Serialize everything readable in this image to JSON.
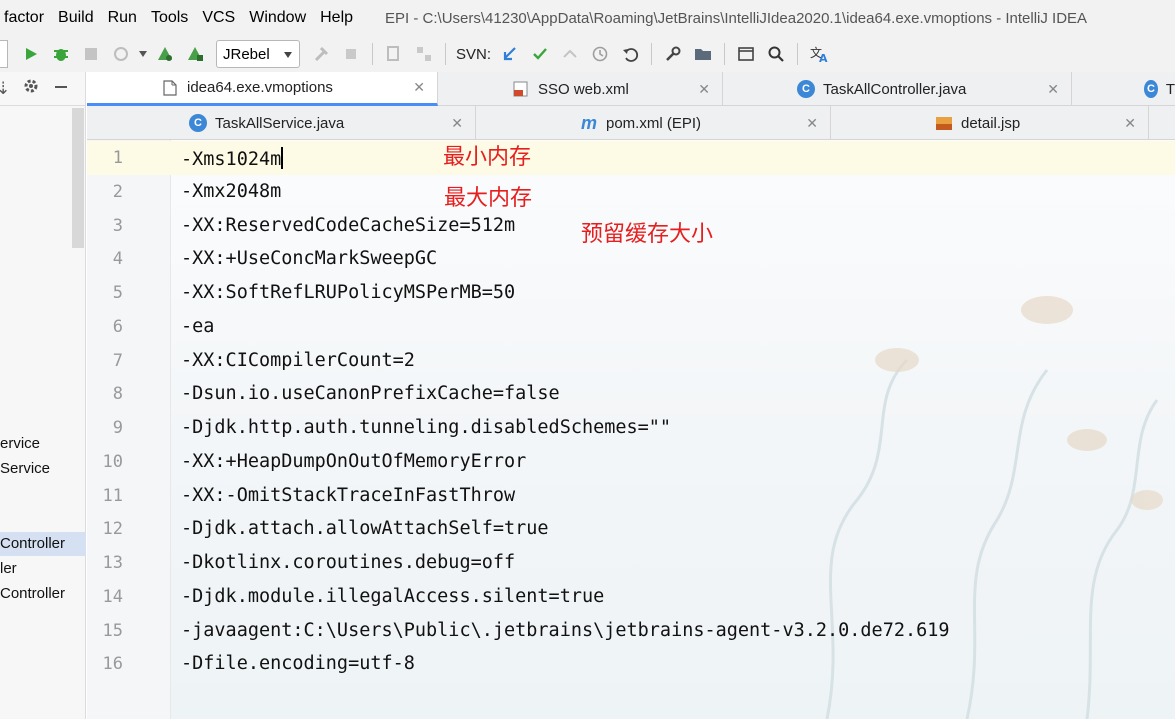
{
  "menubar": {
    "items": [
      "factor",
      "Build",
      "Run",
      "Tools",
      "VCS",
      "Window",
      "Help"
    ],
    "window_title": "EPI - C:\\Users\\41230\\AppData\\Roaming\\JetBrains\\IntelliJIdea2020.1\\idea64.exe.vmoptions - IntelliJ IDEA"
  },
  "toolbar": {
    "run_config": "JRebel",
    "svn_label": "SVN:"
  },
  "left_panel": {
    "items": [
      {
        "label": "ervice",
        "selected": false
      },
      {
        "label": "Service",
        "selected": false
      },
      {
        "label": "Controller",
        "selected": true
      },
      {
        "label": "ler",
        "selected": false
      },
      {
        "label": "Controller",
        "selected": false
      }
    ]
  },
  "tabs": {
    "row1": [
      {
        "label": "idea64.exe.vmoptions",
        "icon": "file-icon",
        "active": true
      },
      {
        "label": "SSO web.xml",
        "icon": "xml-icon",
        "active": false
      },
      {
        "label": "TaskAllController.java",
        "icon": "class-icon",
        "active": false
      },
      {
        "label": "T",
        "icon": "class-icon",
        "active": false
      }
    ],
    "row2": [
      {
        "label": "TaskAllService.java",
        "icon": "class-icon",
        "active": false
      },
      {
        "label": "pom.xml (EPI)",
        "icon": "maven-icon",
        "active": false
      },
      {
        "label": "detail.jsp",
        "icon": "jsp-icon",
        "active": false
      }
    ]
  },
  "editor": {
    "lines": [
      "-Xms1024m",
      "-Xmx2048m",
      "-XX:ReservedCodeCacheSize=512m",
      "-XX:+UseConcMarkSweepGC",
      "-XX:SoftRefLRUPolicyMSPerMB=50",
      "-ea",
      "-XX:CICompilerCount=2",
      "-Dsun.io.useCanonPrefixCache=false",
      "-Djdk.http.auth.tunneling.disabledSchemes=\"\"",
      "-XX:+HeapDumpOnOutOfMemoryError",
      "-XX:-OmitStackTraceInFastThrow",
      "-Djdk.attach.allowAttachSelf=true",
      "-Dkotlinx.coroutines.debug=off",
      "-Djdk.module.illegalAccess.silent=true",
      "-javaagent:C:\\Users\\Public\\.jetbrains\\jetbrains-agent-v3.2.0.de72.619",
      "-Dfile.encoding=utf-8"
    ],
    "line_numbers": [
      "1",
      "2",
      "3",
      "4",
      "5",
      "6",
      "7",
      "8",
      "9",
      "10",
      "11",
      "12",
      "13",
      "14",
      "15",
      "16"
    ],
    "annotations": [
      "最小内存",
      "最大内存",
      "预留缓存大小"
    ],
    "annotation_color": "#e61e1e"
  }
}
